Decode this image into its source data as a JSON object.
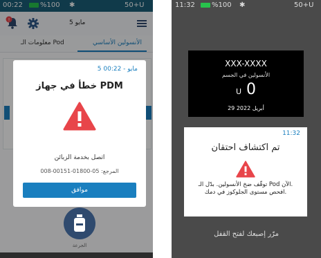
{
  "colors": {
    "accent": "#1a7fbf",
    "warning": "#e8454a",
    "statusbar": "#1b5e78",
    "battery": "#27c24c"
  },
  "left": {
    "status": {
      "time": "00:22",
      "battery": "%100",
      "bluetooth": "✱",
      "insulin": "50+U"
    },
    "appbar": {
      "date": "5 مايو",
      "icons": [
        "notification-bell-icon",
        "gear-icon",
        "hamburger-menu-icon"
      ],
      "badge": "!"
    },
    "tabs": [
      {
        "label": "الأنسولين الأساسي",
        "active": true
      },
      {
        "label": "معلومات الـ Pod",
        "active": false
      }
    ],
    "dialog": {
      "timestamp": "5 مايو - 00:22",
      "title": "خطأ في جهاز PDM",
      "icon": "warning-triangle-icon",
      "message": "اتصل بخدمة الزبائن",
      "reference": "المرجع: 05-01800-00151-008",
      "ok_label": "موافق"
    },
    "bottom": {
      "label": "الجرعة"
    }
  },
  "right": {
    "status": {
      "time": "11:32",
      "battery": "%100",
      "bluetooth": "✱",
      "insulin": "50+U"
    },
    "panel": {
      "serial": "XXX-XXXX",
      "iob_label": "الأنسولين في الجسم",
      "dose_value": "0",
      "dose_unit": "U",
      "date": "29 أبريل 2022"
    },
    "alert": {
      "time": "11:32",
      "title": "تم اكتشاف احتقان",
      "icon": "warning-triangle-icon",
      "message_line1": "توقّف ضخ الأنسولين. بدّل الـ Pod الآن.",
      "message_line2": "افحص مستوى الجلوكوز في دمك."
    },
    "unlock_hint": "مرّر إصبعك لفتح القفل"
  }
}
